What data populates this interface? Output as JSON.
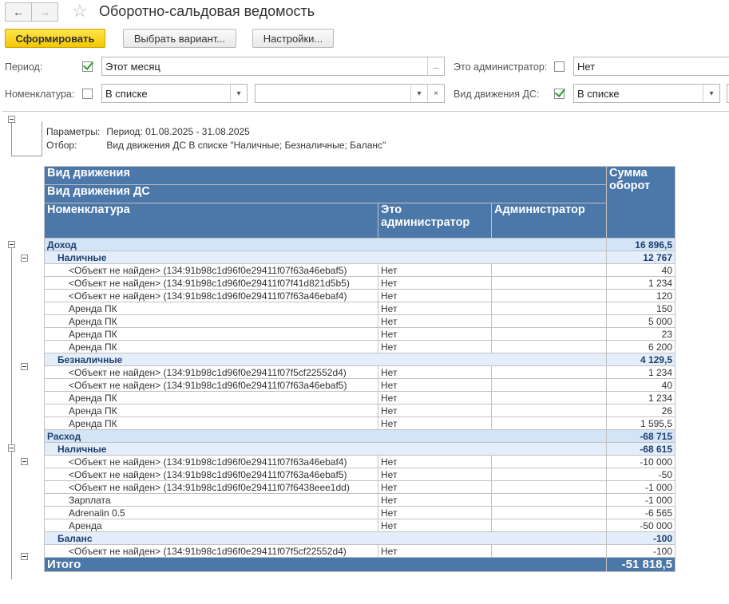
{
  "window": {
    "title": "Оборотно-сальдовая ведомость",
    "back_icon": "←",
    "forward_icon": "→"
  },
  "toolbar": {
    "generate": "Сформировать",
    "choose_variant": "Выбрать вариант...",
    "settings": "Настройки..."
  },
  "filters": {
    "period_label": "Период:",
    "period_value": "Этот месяц",
    "is_admin_label": "Это администратор:",
    "is_admin_value": "Нет",
    "nomenclature_label": "Номенклатура:",
    "nomenclature_mode": "В списке",
    "nomenclature_value": "",
    "movement_label": "Вид движения ДС:",
    "movement_mode": "В списке"
  },
  "params": {
    "params_label": "Параметры:",
    "params_value": "Период: 01.08.2025 - 31.08.2025",
    "filter_label": "Отбор:",
    "filter_value": "Вид движения ДС В списке \"Наличные; Безналичные; Баланс\""
  },
  "header": {
    "movement": "Вид движения",
    "movement_ds": "Вид движения ДС",
    "nomenclature": "Номенклатура",
    "is_admin": "Это администратор",
    "admin": "Администратор",
    "sum": "Сумма оборот"
  },
  "groups": [
    {
      "name": "Доход",
      "total": "16 896,5",
      "subs": [
        {
          "name": "Наличные",
          "total": "12 767",
          "rows": [
            [
              "<Объект не найден> (134:91b98c1d96f0e29411f07f63a46ebaf5)",
              "Нет",
              "",
              "40"
            ],
            [
              "<Объект не найден> (134:91b98c1d96f0e29411f07f41d821d5b5)",
              "Нет",
              "",
              "1 234"
            ],
            [
              "<Объект не найден> (134:91b98c1d96f0e29411f07f63a46ebaf4)",
              "Нет",
              "",
              "120"
            ],
            [
              "Аренда ПК",
              "Нет",
              "",
              "150"
            ],
            [
              "Аренда ПК",
              "Нет",
              "",
              "5 000"
            ],
            [
              "Аренда ПК",
              "Нет",
              "",
              "23"
            ],
            [
              "Аренда ПК",
              "Нет",
              "",
              "6 200"
            ]
          ]
        },
        {
          "name": "Безналичные",
          "total": "4 129,5",
          "rows": [
            [
              "<Объект не найден> (134:91b98c1d96f0e29411f07f5cf22552d4)",
              "Нет",
              "",
              "1 234"
            ],
            [
              "<Объект не найден> (134:91b98c1d96f0e29411f07f63a46ebaf5)",
              "Нет",
              "",
              "40"
            ],
            [
              "Аренда ПК",
              "Нет",
              "",
              "1 234"
            ],
            [
              "Аренда ПК",
              "Нет",
              "",
              "26"
            ],
            [
              "Аренда ПК",
              "Нет",
              "",
              "1 595,5"
            ]
          ]
        }
      ]
    },
    {
      "name": "Расход",
      "total": "-68 715",
      "subs": [
        {
          "name": "Наличные",
          "total": "-68 615",
          "rows": [
            [
              "<Объект не найден> (134:91b98c1d96f0e29411f07f63a46ebaf4)",
              "Нет",
              "",
              "-10 000"
            ],
            [
              "<Объект не найден> (134:91b98c1d96f0e29411f07f63a46ebaf5)",
              "Нет",
              "",
              "-50"
            ],
            [
              "<Объект не найден> (134:91b98c1d96f0e29411f07f6438eee1dd)",
              "Нет",
              "",
              "-1 000"
            ],
            [
              "Зарплата",
              "Нет",
              "",
              "-1 000"
            ],
            [
              "Adrenalin 0.5",
              "Нет",
              "",
              "-6 565"
            ],
            [
              "Аренда",
              "Нет",
              "",
              "-50 000"
            ]
          ]
        },
        {
          "name": "Баланс",
          "total": "-100",
          "rows": [
            [
              "<Объект не найден> (134:91b98c1d96f0e29411f07f5cf22552d4)",
              "Нет",
              "",
              "-100"
            ]
          ]
        }
      ]
    }
  ],
  "total": {
    "label": "Итого",
    "value": "-51 818,5"
  }
}
